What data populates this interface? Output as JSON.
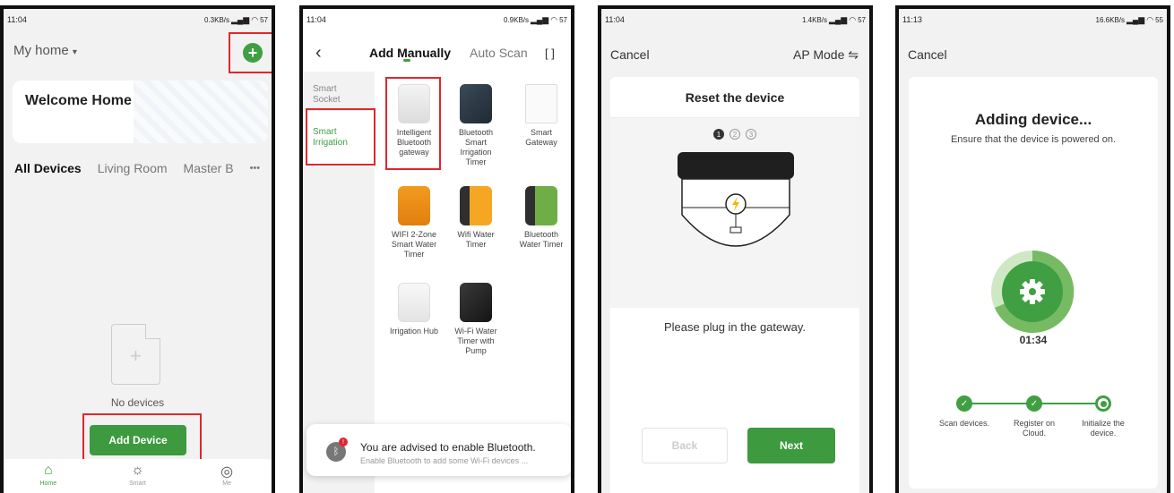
{
  "screen1": {
    "status_time": "11:04",
    "status_speed": "0.3KB/s",
    "status_battery": "57",
    "home_title": "My home",
    "welcome": "Welcome Home",
    "tabs": [
      "All Devices",
      "Living Room",
      "Master B"
    ],
    "more": "•••",
    "empty_text": "No devices",
    "add_device_label": "Add Device",
    "nav": [
      {
        "label": "Home",
        "icon": "home-icon"
      },
      {
        "label": "Smart",
        "icon": "sun-icon"
      },
      {
        "label": "Me",
        "icon": "profile-icon"
      }
    ]
  },
  "screen2": {
    "status_time": "11:04",
    "status_speed": "0.9KB/s",
    "status_battery": "57",
    "tab_manual": "Add Manually",
    "tab_auto": "Auto Scan",
    "sidebar": [
      "Smart Socket",
      "Smart Irrigation"
    ],
    "devices": [
      "Intelligent Bluetooth gateway",
      "Bluetooth Smart Irrigation Timer",
      "Smart Gateway",
      "WIFI 2-Zone Smart Water Timer",
      "Wifi Water Timer",
      "Bluetooth Water Timer",
      "Irrigation Hub",
      "Wi-Fi Water Timer with Pump"
    ],
    "toast_title": "You are advised to enable Bluetooth.",
    "toast_sub": "Enable Bluetooth to add some Wi-Fi devices ...",
    "toast_badge": "!"
  },
  "screen3": {
    "status_time": "11:04",
    "status_speed": "1.4KB/s",
    "status_battery": "57",
    "cancel": "Cancel",
    "mode": "AP Mode ⇋",
    "card_title": "Reset the device",
    "steps": [
      "1",
      "2",
      "3"
    ],
    "hint": "Please plug in the gateway.",
    "back_label": "Back",
    "next_label": "Next"
  },
  "screen4": {
    "status_time": "11:13",
    "status_speed": "16.6KB/s",
    "status_battery": "55",
    "cancel": "Cancel",
    "title": "Adding device...",
    "subtitle": "Ensure that the device is powered on.",
    "timer": "01:34",
    "progress_labels": [
      "Scan devices.",
      "Register on Cloud.",
      "Initialize the device."
    ]
  },
  "colors": {
    "accent": "#3f9f42",
    "highlight": "#e0262d"
  }
}
